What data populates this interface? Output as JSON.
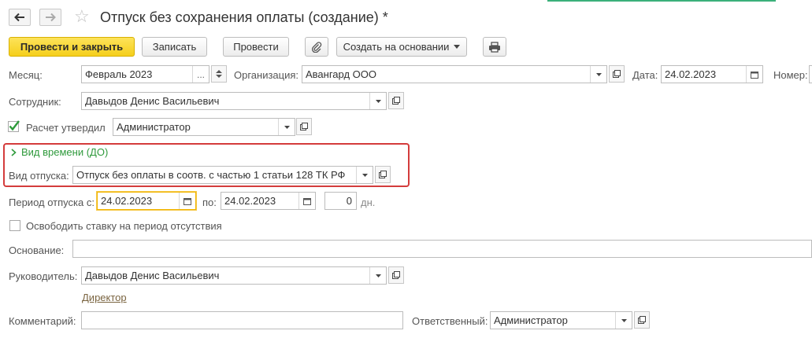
{
  "window": {
    "title": "Отпуск без сохранения оплаты (создание) *"
  },
  "toolbar": {
    "post_close": "Провести и закрыть",
    "save": "Записать",
    "post": "Провести",
    "create_based": "Создать на основании"
  },
  "form": {
    "month": {
      "label": "Месяц:",
      "value": "Февраль 2023",
      "ellipsis": "..."
    },
    "organization": {
      "label": "Организация:",
      "value": "Авангард ООО"
    },
    "date": {
      "label": "Дата:",
      "value": "24.02.2023"
    },
    "number": {
      "label": "Номер:"
    },
    "employee": {
      "label": "Сотрудник:",
      "value": "Давыдов Денис Васильевич"
    },
    "approved": {
      "label": "Расчет утвердил",
      "checked": true,
      "value": "Администратор"
    },
    "time_type_group": {
      "title": "Вид времени (ДО)"
    },
    "vacation_type": {
      "label": "Вид отпуска:",
      "value": "Отпуск без оплаты в соотв. с частью 1 статьи 128 ТК РФ"
    },
    "period": {
      "label": "Период отпуска с:",
      "from": "24.02.2023",
      "to_label": "по:",
      "to": "24.02.2023",
      "days": "0",
      "days_unit": "дн."
    },
    "free_rate": {
      "label": "Освободить ставку на период отсутствия",
      "checked": false
    },
    "basis": {
      "label": "Основание:",
      "value": ""
    },
    "manager": {
      "label": "Руководитель:",
      "value": "Давыдов Денис Васильевич",
      "position": "Директор"
    },
    "comment": {
      "label": "Комментарий:",
      "value": ""
    },
    "responsible": {
      "label": "Ответственный:",
      "value": "Администратор"
    }
  },
  "colors": {
    "accent_yellow": "#f5cf1c",
    "highlight_red": "#d43c3c",
    "group_green": "#2f9a3c"
  }
}
